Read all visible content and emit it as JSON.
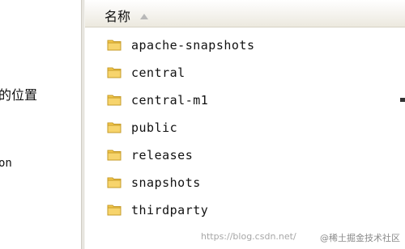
{
  "left_pane": {
    "text_1": "的位置",
    "text_2": "on"
  },
  "file_pane": {
    "column_header": {
      "name_label": "名称",
      "sort_icon": "sort-up-icon"
    },
    "items": [
      {
        "name": "apache-snapshots",
        "icon": "folder-icon"
      },
      {
        "name": "central",
        "icon": "folder-icon"
      },
      {
        "name": "central-m1",
        "icon": "folder-icon"
      },
      {
        "name": "public",
        "icon": "folder-icon"
      },
      {
        "name": "releases",
        "icon": "folder-icon"
      },
      {
        "name": "snapshots",
        "icon": "folder-icon"
      },
      {
        "name": "thirdparty",
        "icon": "folder-icon"
      }
    ]
  },
  "watermark": {
    "text_url": "https://blog.csdn.net/",
    "text_brand": "@稀土掘金技术社区"
  },
  "colors": {
    "folder_fill": "#f5c84a",
    "folder_stroke": "#c59b2a",
    "header_bg_top": "#ffffff",
    "header_bg_bottom": "#ece9df"
  }
}
